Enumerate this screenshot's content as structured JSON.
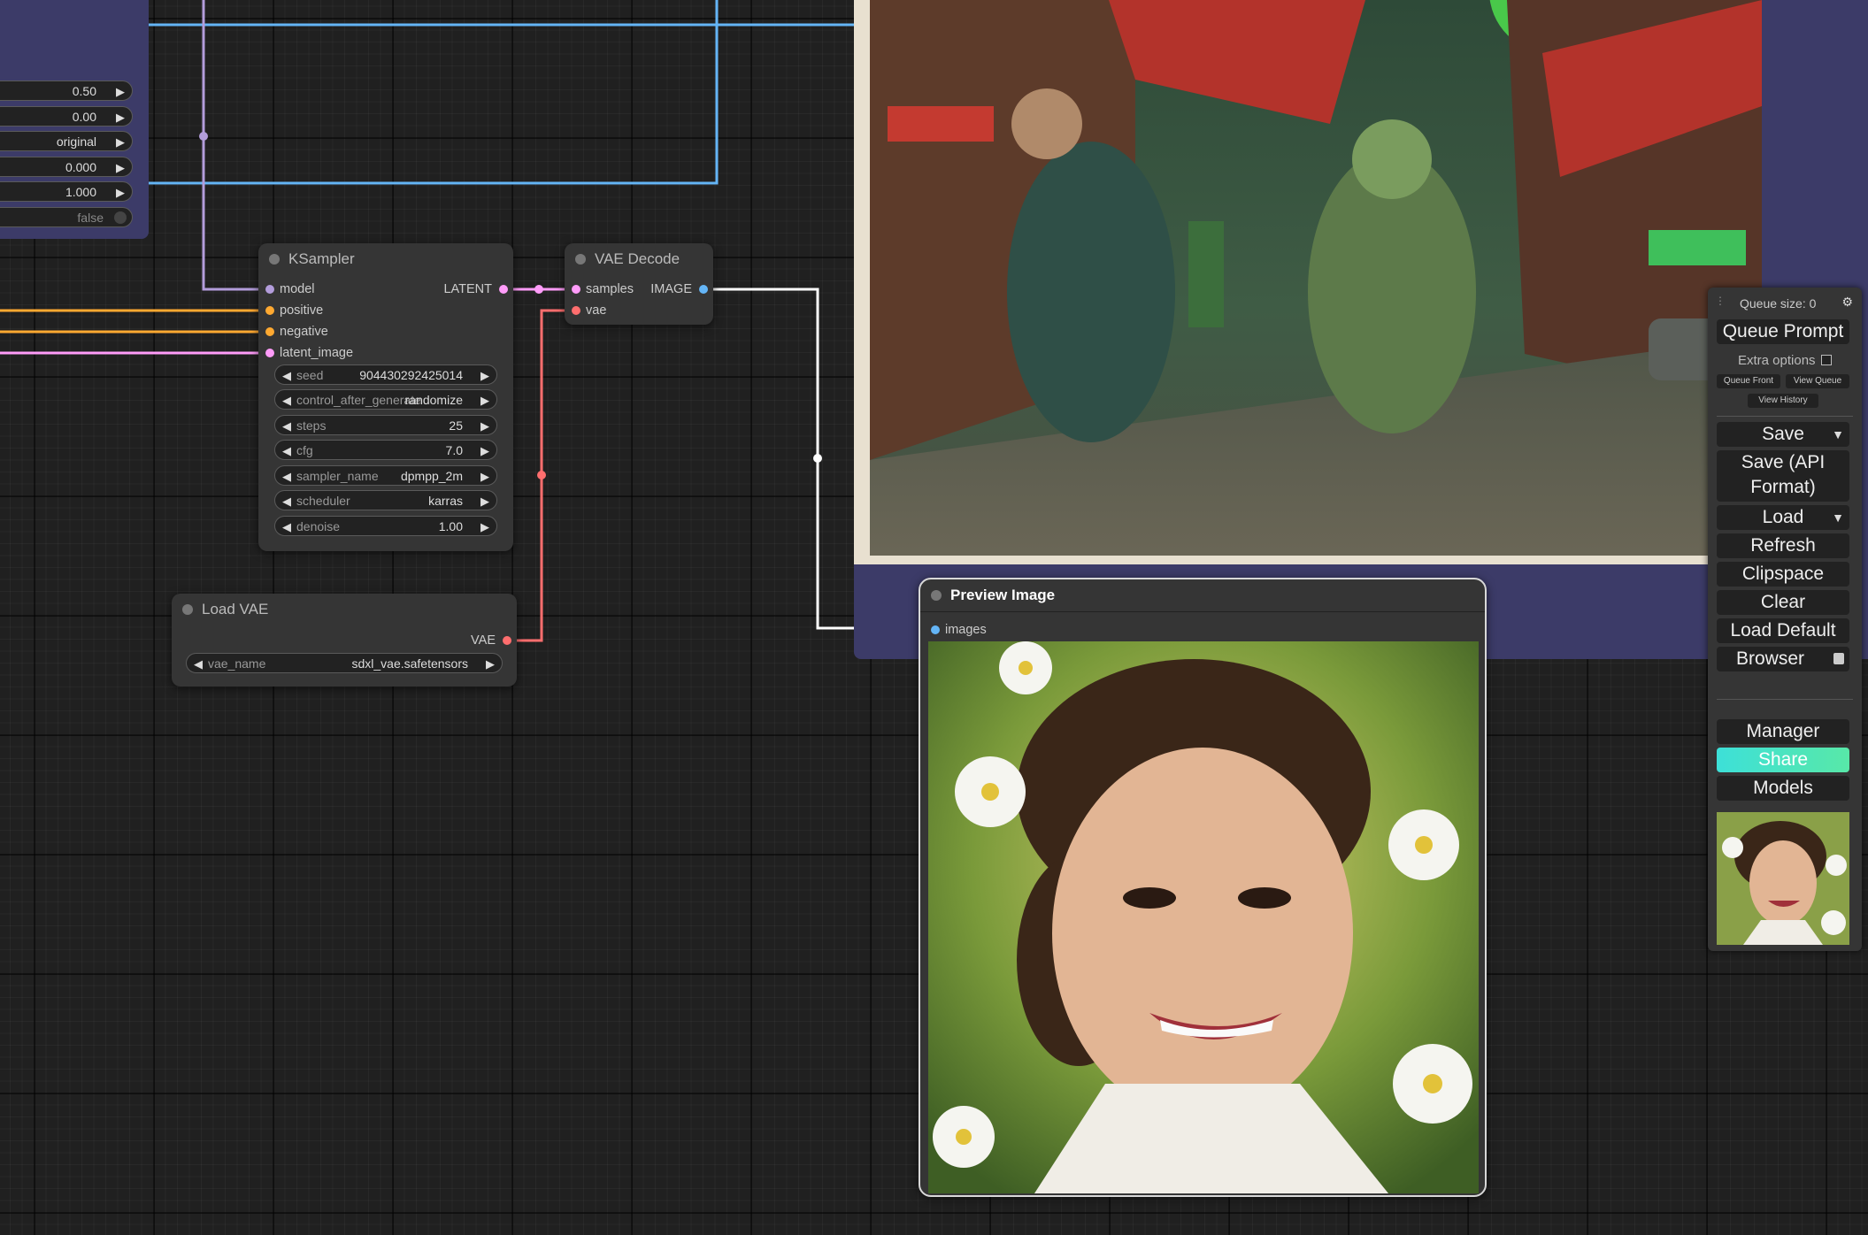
{
  "partial_node": {
    "values": [
      "0.50",
      "0.00",
      "original",
      "0.000",
      "1.000"
    ],
    "toggle_value": "false"
  },
  "ksampler": {
    "title": "KSampler",
    "inputs": [
      "model",
      "positive",
      "negative",
      "latent_image"
    ],
    "output": "LATENT",
    "widgets": [
      {
        "name": "seed",
        "value": "904430292425014"
      },
      {
        "name": "control_after_generate",
        "value": "randomize"
      },
      {
        "name": "steps",
        "value": "25"
      },
      {
        "name": "cfg",
        "value": "7.0"
      },
      {
        "name": "sampler_name",
        "value": "dpmpp_2m"
      },
      {
        "name": "scheduler",
        "value": "karras"
      },
      {
        "name": "denoise",
        "value": "1.00"
      }
    ]
  },
  "vae_decode": {
    "title": "VAE Decode",
    "inputs": [
      "samples",
      "vae"
    ],
    "output": "IMAGE"
  },
  "load_vae": {
    "title": "Load VAE",
    "output": "VAE",
    "widget": {
      "name": "vae_name",
      "value": "sdxl_vae.safetensors"
    }
  },
  "preview": {
    "title": "Preview Image",
    "input": "images"
  },
  "menu": {
    "queue_size_label": "Queue size: 0",
    "queue_prompt": "Queue Prompt",
    "extra_options": "Extra options",
    "queue_front": "Queue Front",
    "view_queue": "View Queue",
    "view_history": "View History",
    "save": "Save",
    "save_api_line1": "Save (API",
    "save_api_line2": "Format)",
    "load": "Load",
    "refresh": "Refresh",
    "clipspace": "Clipspace",
    "clear": "Clear",
    "load_default": "Load Default",
    "browser": "Browser",
    "manager": "Manager",
    "share": "Share",
    "models": "Models"
  },
  "colors": {
    "model_link": "#b39ddb",
    "conditioning_link": "#ffa931",
    "latent_link": "#ff9cf9",
    "vae_link": "#ff6e6e",
    "image_link": "#64b5f6",
    "group_bg": "#3c3b68",
    "share_accent": "#3de0d8"
  }
}
